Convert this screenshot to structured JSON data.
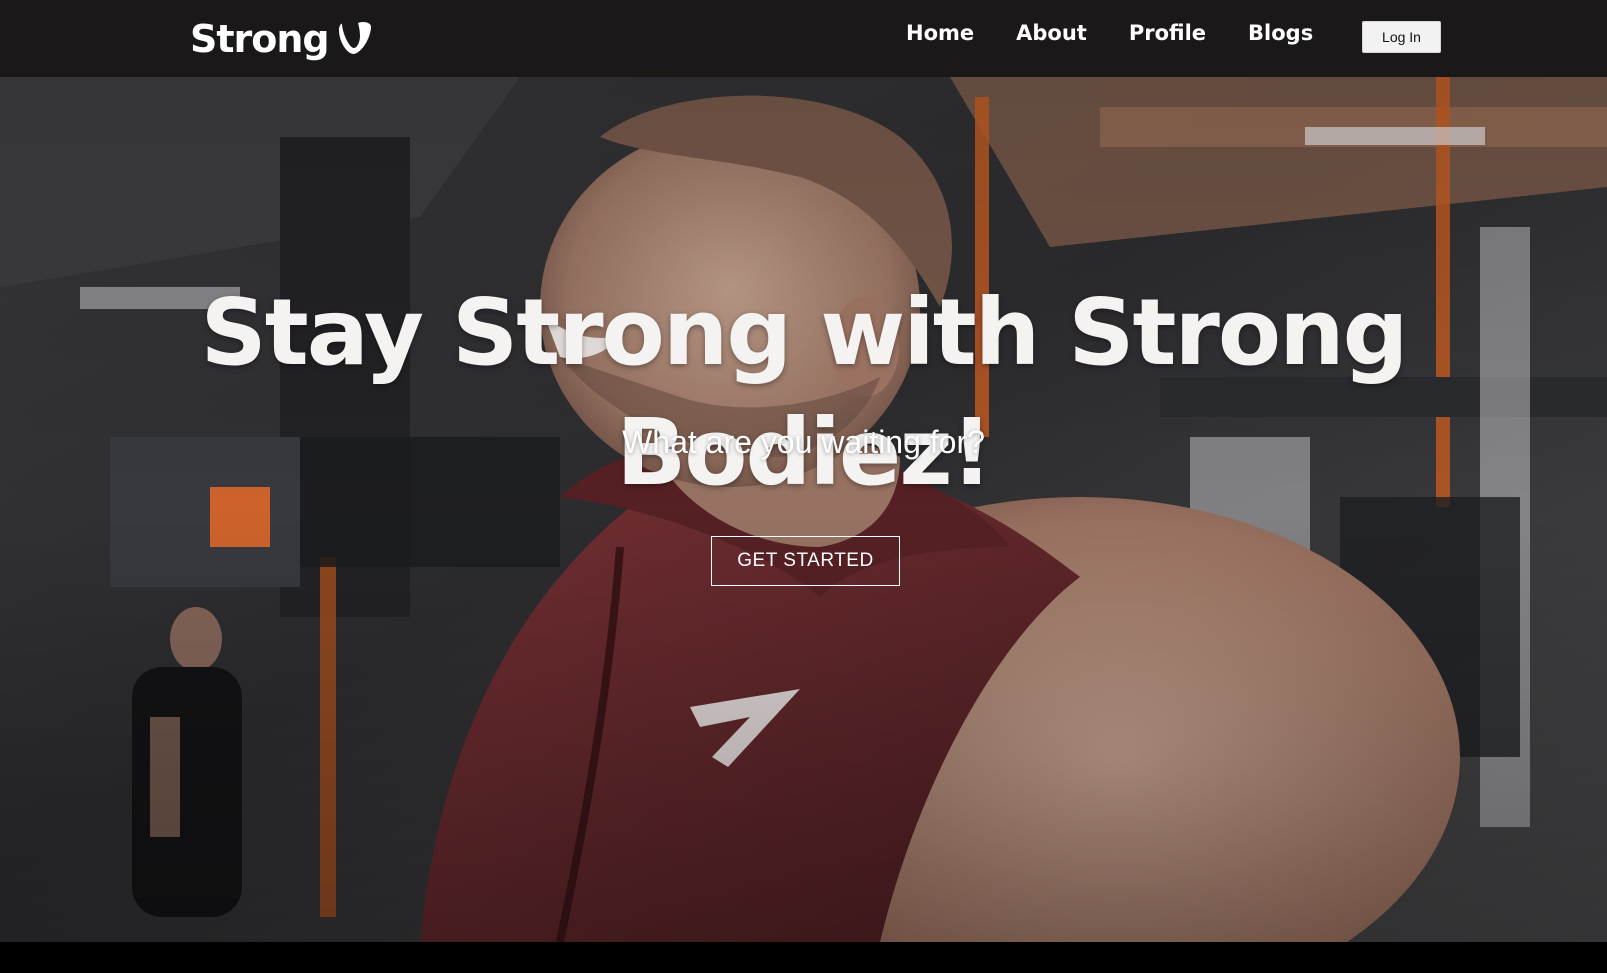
{
  "nav": {
    "logo_text": "Strong",
    "links": [
      "Home",
      "About",
      "Profile",
      "Blogs"
    ],
    "login_label": "Log In"
  },
  "hero": {
    "title": "Stay Strong with Strong Bodiez!",
    "subtitle": "What are you waiting for?",
    "cta_label": "GET STARTED"
  },
  "colors": {
    "nav_background": "#1b1819",
    "text": "#ffffff",
    "login_button": "#f2f2f2",
    "hoodie": "#6b2a2e",
    "gym_accent": "#d8682d"
  },
  "icons": {
    "logo": "typo3-logo-icon",
    "hero_image": "gym-athlete-photo"
  }
}
